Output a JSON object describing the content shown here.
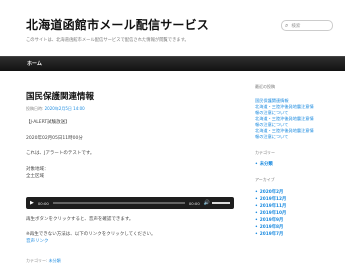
{
  "header": {
    "site_title": "北海道函館市メール配信サービス",
    "site_description": "このサイトは、北海道函館市メール配信サービスで配信された情報が閲覧できます。",
    "search_placeholder": "検索"
  },
  "nav": {
    "home_label": "ホーム"
  },
  "post": {
    "title": "国民保護関連情報",
    "meta_prefix": "投稿日時:",
    "meta_date": "2020年2月5日 14:00",
    "header_line": "【J-ALERT試験放送】",
    "date_line": "2020年02月05日11時00分",
    "body_line": "これは、Jアラートのテストです。",
    "area_label": "対象地域：",
    "area_value": "全土区域",
    "audio": {
      "current_time": "00:00",
      "duration": "00:00"
    },
    "instruction1": "再生ボタンをクリックすると、音声を確認できます。",
    "instruction2": "※再生できない方法は、以下のリンクをクリックしてください。",
    "audio_link": "音声リンク",
    "category_prefix": "カテゴリー:",
    "category_value": "未分類"
  },
  "sidebar": {
    "recent_posts_title": "最近の投稿",
    "recent_posts": [
      "国民保護関連情報",
      "北海道・三陸沖後発地震注意情",
      "報の注意について",
      "北海道・三陸沖後発地震注意情",
      "報の注意について",
      "北海道・三陸沖後発地震注意情",
      "報の注意について"
    ],
    "categories_title": "カテゴリー",
    "categories": [
      "未分類"
    ],
    "archives_title": "アーカイブ",
    "archives": [
      "2020年2月",
      "2019年12月",
      "2019年11月",
      "2019年10月",
      "2019年9月",
      "2019年8月",
      "2019年7月"
    ]
  },
  "colors": {
    "link": "#1b8be0",
    "navbar": "#1a1a1a"
  }
}
